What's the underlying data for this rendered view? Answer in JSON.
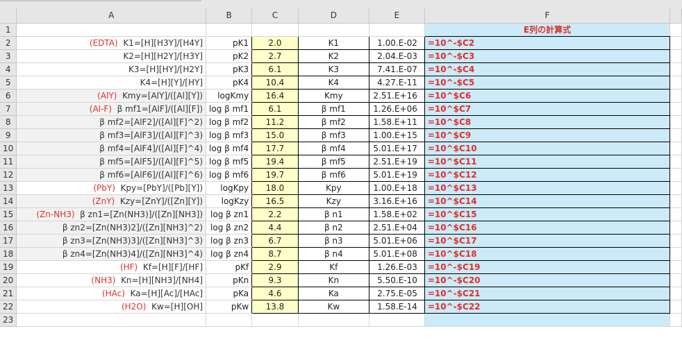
{
  "columns": [
    "A",
    "B",
    "C",
    "D",
    "E",
    "F"
  ],
  "f_header": "E列の計算式",
  "rows": [
    {
      "n": "2",
      "tag": "(EDTA)",
      "a": "K1=[H][H3Y]/[H4Y]",
      "b": "pK1",
      "c": "2.0",
      "d": "K1",
      "e": "1.00.E-02",
      "f": "=10^-$C2"
    },
    {
      "n": "3",
      "tag": "",
      "a": "K2=[H][H2Y]/[H3Y]",
      "b": "pK2",
      "c": "2.7",
      "d": "K2",
      "e": "2.04.E-03",
      "f": "=10^-$C3"
    },
    {
      "n": "4",
      "tag": "",
      "a": "K3=[H][HY]/[H2Y]",
      "b": "pK3",
      "c": "6.1",
      "d": "K3",
      "e": "7.41.E-07",
      "f": "=10^-$C4"
    },
    {
      "n": "5",
      "tag": "",
      "a": "K4=[H][Y]/[HY]",
      "b": "pK4",
      "c": "10.4",
      "d": "K4",
      "e": "4.27.E-11",
      "f": "=10^-$C5"
    },
    {
      "n": "6",
      "tag": "(AlY)",
      "a": "Kmy=[AlY]/([Al][Y])",
      "b": "logKmy",
      "c": "16.4",
      "d": "Kmy",
      "e": "2.51.E+16",
      "f": "=10^$C6"
    },
    {
      "n": "7",
      "tag": "(Al-F)",
      "a": "β mf1=[AlF]/([Al][F])",
      "b": "log β mf1",
      "c": "6.1",
      "d": "β mf1",
      "e": "1.26.E+06",
      "f": "=10^$C7"
    },
    {
      "n": "8",
      "tag": "",
      "a": "β mf2=[AlF2]/([Al][F]^2)",
      "b": "log β mf2",
      "c": "11.2",
      "d": "β mf2",
      "e": "1.58.E+11",
      "f": "=10^$C8"
    },
    {
      "n": "9",
      "tag": "",
      "a": "β mf3=[AlF3]/([Al][F]^3)",
      "b": "log β mf3",
      "c": "15.0",
      "d": "β mf3",
      "e": "1.00.E+15",
      "f": "=10^$C9"
    },
    {
      "n": "10",
      "tag": "",
      "a": "β mf4=[AlF4]/([Al][F]^4)",
      "b": "log β mf4",
      "c": "17.7",
      "d": "β mf4",
      "e": "5.01.E+17",
      "f": "=10^$C10"
    },
    {
      "n": "11",
      "tag": "",
      "a": "β mf5=[AlF5]/([Al][F]^5)",
      "b": "log β mf5",
      "c": "19.4",
      "d": "β mf5",
      "e": "2.51.E+19",
      "f": "=10^$C11"
    },
    {
      "n": "12",
      "tag": "",
      "a": "β mf6=[AlF6]/([Al][F]^6)",
      "b": "log β mf6",
      "c": "19.7",
      "d": "β mf6",
      "e": "5.01.E+19",
      "f": "=10^$C12"
    },
    {
      "n": "13",
      "tag": "(PbY)",
      "a": "Kpy=[PbY]/([Pb][Y])",
      "b": "logKpy",
      "c": "18.0",
      "d": "Kpy",
      "e": "1.00.E+18",
      "f": "=10^$C13"
    },
    {
      "n": "14",
      "tag": "(ZnY)",
      "a": "Kzy=[ZnY]/([Zn][Y])",
      "b": "logKzy",
      "c": "16.5",
      "d": "Kzy",
      "e": "3.16.E+16",
      "f": "=10^$C14"
    },
    {
      "n": "15",
      "tag": "(Zn-NH3)",
      "a": "β zn1=[Zn(NH3)]/([Zn][NH3])",
      "b": "log β zn1",
      "c": "2.2",
      "d": "β n1",
      "e": "1.58.E+02",
      "f": "=10^$C15"
    },
    {
      "n": "16",
      "tag": "",
      "a": "β zn2=[Zn(NH3)2]/([Zn][NH3]^2)",
      "b": "log β zn2",
      "c": "4.4",
      "d": "β n2",
      "e": "2.51.E+04",
      "f": "=10^$C16"
    },
    {
      "n": "17",
      "tag": "",
      "a": "β zn3=[Zn(NH3)3]/([Zn][NH3]^3)",
      "b": "log β zn3",
      "c": "6.7",
      "d": "β n3",
      "e": "5.01.E+06",
      "f": "=10^$C17"
    },
    {
      "n": "18",
      "tag": "",
      "a": "β zn4=[Zn(NH3)4]/([Zn][NH3]^4)",
      "b": "log β zn4",
      "c": "8.7",
      "d": "β n4",
      "e": "5.01.E+08",
      "f": "=10^$C18"
    },
    {
      "n": "19",
      "tag": "(HF)",
      "a": "Kf=[H][F]/[HF]",
      "b": "pKf",
      "c": "2.9",
      "d": "Kf",
      "e": "1.26.E-03",
      "f": "=10^-$C19"
    },
    {
      "n": "20",
      "tag": "(NH3)",
      "a": "Kn=[H][NH3]/[NH4]",
      "b": "pKn",
      "c": "9.3",
      "d": "Kn",
      "e": "5.50.E-10",
      "f": "=10^-$C20"
    },
    {
      "n": "21",
      "tag": "(HAc)",
      "a": "Ka=[H][Ac]/[HAc]",
      "b": "pKa",
      "c": "4.6",
      "d": "Ka",
      "e": "2.75.E-05",
      "f": "=10^-$C21"
    },
    {
      "n": "22",
      "tag": "(H2O)",
      "a": "Kw=[H][OH]",
      "b": "pKw",
      "c": "13.8",
      "d": "Kw",
      "e": "1.58.E-14",
      "f": "=10^-$C22"
    }
  ],
  "colors": {
    "input_cell": "#ffffc9",
    "formula_cell": "#cceaf7",
    "formula_text": "#e0302a",
    "tag_text": "#e0302a"
  }
}
